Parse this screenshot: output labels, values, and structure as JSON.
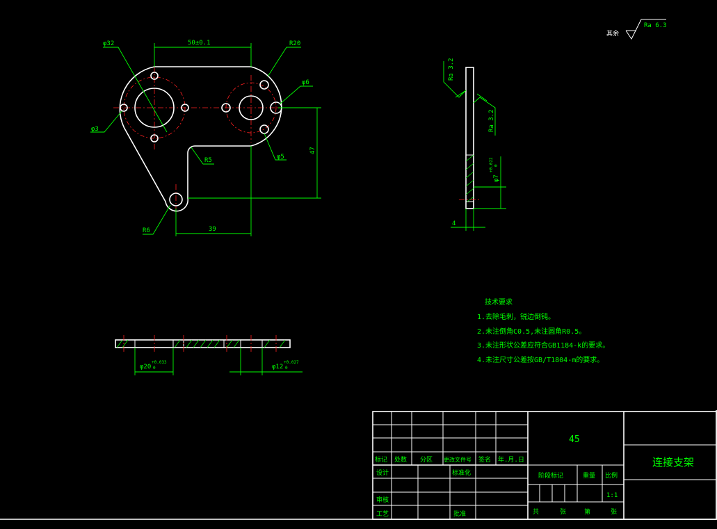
{
  "roughness": {
    "other_label": "其余",
    "other_value": "Ra 6.3",
    "side_top": "Ra 3.2",
    "side_bottom": "Ra 3.2"
  },
  "dimensions": {
    "dia32": "φ32",
    "span50": "50±0.1",
    "r20": "R20",
    "dia6": "φ6",
    "dia3": "φ3",
    "r5": "R5",
    "dia5": "φ5",
    "h47": "47",
    "r6": "R6",
    "w39": "39",
    "side_dia": "φ7",
    "side_dia_tol": "+0.022",
    "side_dia_tol2": "0",
    "thickness": "4",
    "dia20": "φ20",
    "dia20_tol_up": "+0.033",
    "dia20_tol_lo": "0",
    "dia12": "φ12",
    "dia12_tol_up": "+0.027",
    "dia12_tol_lo": "0"
  },
  "tech_requirements": {
    "title": "技术要求",
    "items": [
      "1.去除毛刺，锐边倒钝。",
      "2.未注倒角C0.5,未注圆角R0.5。",
      "3.未注形状公差应符合GB1184-k的要求。",
      "4.未注尺寸公差按GB/T1804-m的要求。"
    ]
  },
  "title_block": {
    "header_cols": [
      "标记",
      "处数",
      "分区",
      "更改文件号",
      "签名",
      "年.月.日"
    ],
    "design": "设计",
    "standardize": "标准化",
    "review": "审核",
    "process": "工艺",
    "approve": "批准",
    "material": "45",
    "stage_mark": "阶段标记",
    "weight": "重量",
    "scale": "比例",
    "scale_value": "1:1",
    "sheet_total": "共",
    "sheet_unit1": "张",
    "sheet_no": "第",
    "sheet_unit2": "张",
    "part_name": "连接支架"
  }
}
